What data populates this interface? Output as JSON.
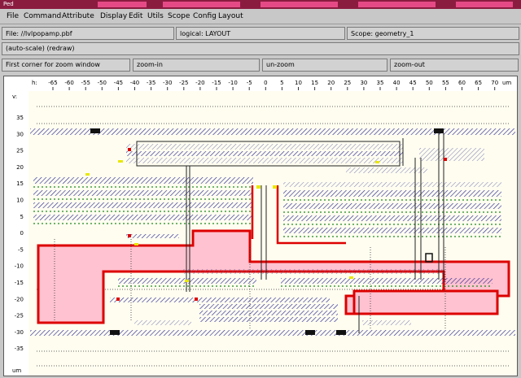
{
  "window": {
    "title": "Ped"
  },
  "menu": [
    "File",
    "Command",
    "Attribute",
    "Display",
    "Edit",
    "Utils",
    "Scope",
    "Config",
    "Layout"
  ],
  "info": {
    "file": "File: //lvlpopamp.pbf",
    "logical": "logical: LAYOUT",
    "scope": "Scope: geometry_1"
  },
  "status": {
    "line": "(auto-scale) (redraw)"
  },
  "prompt": {
    "text": "First corner for zoom window"
  },
  "buttons": {
    "zoom_in": "zoom-in",
    "un_zoom": "un-zoom",
    "zoom_out": "zoom-out"
  },
  "axes": {
    "x_label": "h:",
    "x_unit": "um",
    "y_label": "v:",
    "y_unit": "um",
    "x_ticks": [
      "-65",
      "-60",
      "-55",
      "-50",
      "-45",
      "-40",
      "-35",
      "-30",
      "-25",
      "-20",
      "-15",
      "-10",
      "-5",
      "0",
      "5",
      "10",
      "15",
      "20",
      "25",
      "30",
      "35",
      "40",
      "45",
      "50",
      "55",
      "60",
      "65",
      "70"
    ],
    "y_ticks": [
      "35",
      "30",
      "25",
      "20",
      "15",
      "10",
      "5",
      "0",
      "-5",
      "-10",
      "-15",
      "-20",
      "-25",
      "-30",
      "-35"
    ]
  },
  "colors": {
    "well": "#ffc2d0",
    "well_border": "#dd0000",
    "hatch": "#2a2a9a",
    "metal_stripe": "#d8d8d8",
    "contact": "#1a8a1a",
    "diffusion": "#e8e800"
  }
}
